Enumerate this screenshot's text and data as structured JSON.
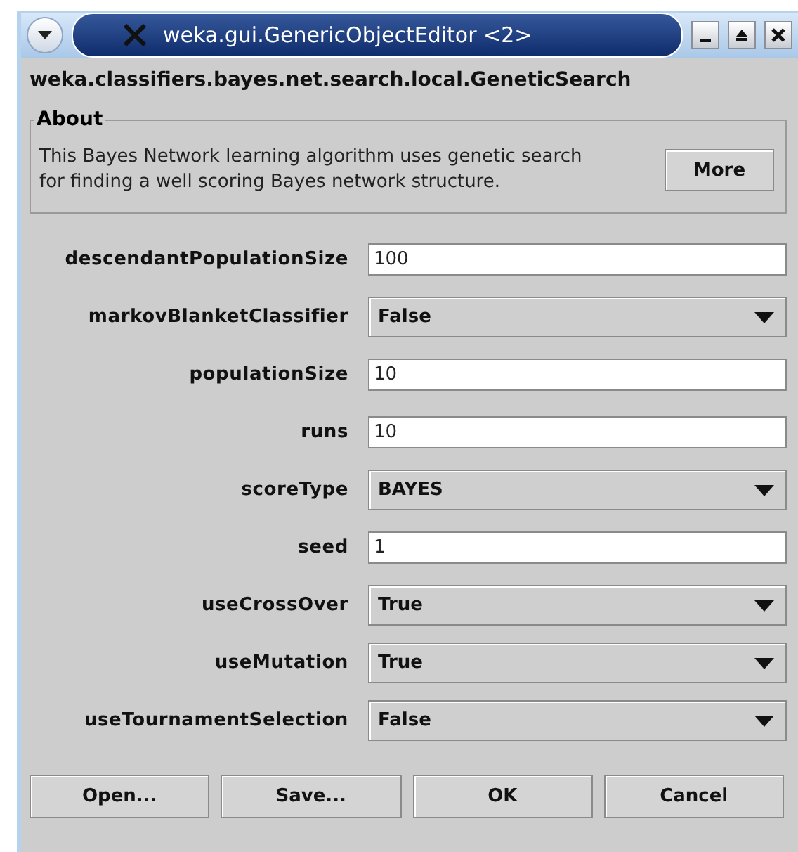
{
  "window": {
    "title": "weka.gui.GenericObjectEditor <2>"
  },
  "class_name": "weka.classifiers.bayes.net.search.local.GeneticSearch",
  "about": {
    "legend": "About",
    "text": "This Bayes Network learning algorithm uses genetic search for finding a well scoring Bayes network structure.",
    "button": "More"
  },
  "properties": [
    {
      "label": "descendantPopulationSize",
      "kind": "text",
      "value": "100"
    },
    {
      "label": "markovBlanketClassifier",
      "kind": "choice",
      "value": "False"
    },
    {
      "label": "populationSize",
      "kind": "text",
      "value": "10"
    },
    {
      "label": "runs",
      "kind": "text",
      "value": "10"
    },
    {
      "label": "scoreType",
      "kind": "choice",
      "value": "BAYES"
    },
    {
      "label": "seed",
      "kind": "text",
      "value": "1"
    },
    {
      "label": "useCrossOver",
      "kind": "choice",
      "value": "True"
    },
    {
      "label": "useMutation",
      "kind": "choice",
      "value": "True"
    },
    {
      "label": "useTournamentSelection",
      "kind": "choice",
      "value": "False"
    }
  ],
  "buttons": [
    "Open...",
    "Save...",
    "OK",
    "Cancel"
  ]
}
